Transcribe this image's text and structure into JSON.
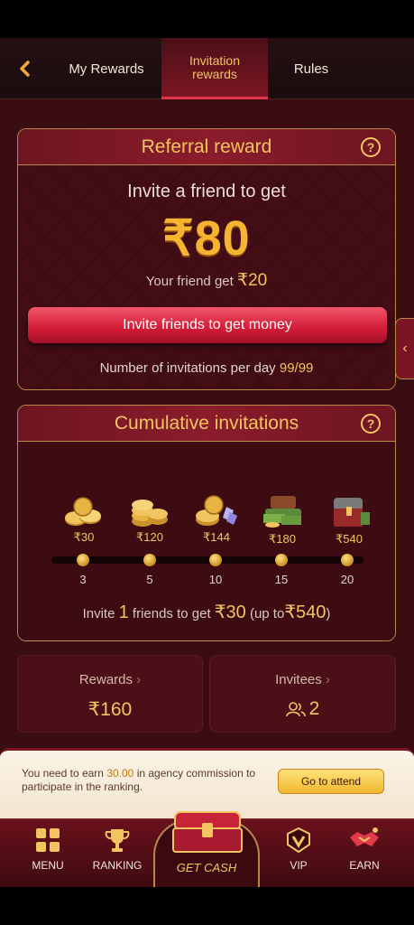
{
  "header": {
    "tabs": [
      {
        "label": "My Rewards"
      },
      {
        "label": "Invitation rewards"
      },
      {
        "label": "Rules"
      }
    ],
    "active_tab": "Invitation rewards"
  },
  "referral": {
    "title": "Referral reward",
    "invite_text": "Invite a friend to get",
    "amount": "₹80",
    "friend_get_prefix": "Your friend get",
    "friend_get_amount": "₹20",
    "button_label": "Invite friends to get money",
    "per_day_label": "Number of invitations per day",
    "per_day_count": "99/99"
  },
  "cumulative": {
    "title": "Cumulative invitations",
    "tiers": [
      {
        "reward": "₹30",
        "friends": "3",
        "icon": "coins-icon"
      },
      {
        "reward": "₹120",
        "friends": "5",
        "icon": "coin-stack-icon"
      },
      {
        "reward": "₹144",
        "friends": "10",
        "icon": "coins-gems-icon"
      },
      {
        "reward": "₹180",
        "friends": "15",
        "icon": "cash-chest-icon"
      },
      {
        "reward": "₹540",
        "friends": "20",
        "icon": "treasure-chest-icon"
      }
    ],
    "summary": {
      "prefix": "Invite",
      "count": "1",
      "middle": "friends to get",
      "amount": "₹30",
      "suffix_open": "(up to",
      "max": "₹540",
      "suffix_close": ")"
    }
  },
  "stats": {
    "rewards_label": "Rewards",
    "rewards_value": "₹160",
    "invitees_label": "Invitees",
    "invitees_value": "2"
  },
  "notice": {
    "text_before": "You need to earn",
    "amount": "30.00",
    "text_after": "in agency commission to participate in the ranking.",
    "button_label": "Go to attend"
  },
  "nav": {
    "items": [
      {
        "label": "MENU"
      },
      {
        "label": "RANKING"
      },
      {
        "label": "GET CASH"
      },
      {
        "label": "VIP"
      },
      {
        "label": "EARN"
      }
    ]
  },
  "colors": {
    "accent_gold": "#f2c561",
    "background": "#3a0d12",
    "button_red": "#d21b36"
  }
}
